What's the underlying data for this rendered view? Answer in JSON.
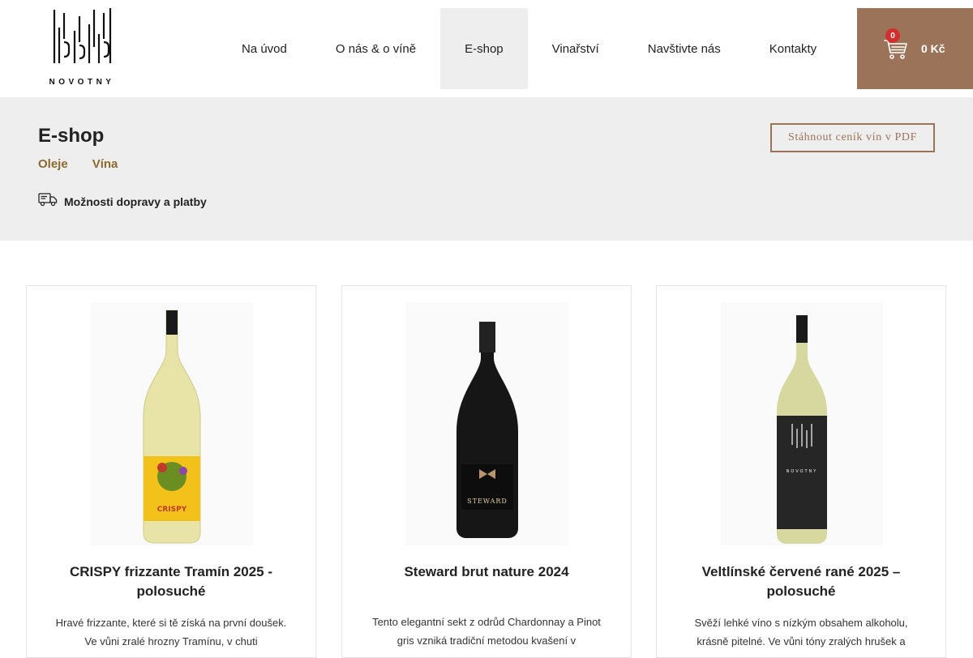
{
  "brand": {
    "name": "NOVOTNY"
  },
  "nav": {
    "items": [
      {
        "label": "Na úvod"
      },
      {
        "label": "O nás & o víně"
      },
      {
        "label": "E-shop"
      },
      {
        "label": "Vinařství"
      },
      {
        "label": "Navštivte nás"
      },
      {
        "label": "Kontakty"
      }
    ],
    "active": "E-shop"
  },
  "cart": {
    "count": "0",
    "total": "0 Kč",
    "icon": "cart-icon",
    "bg_color": "#9a7359",
    "badge_color": "#d32f2f"
  },
  "page": {
    "title": "E-shop",
    "categories": [
      {
        "label": "Oleje"
      },
      {
        "label": "Vína"
      }
    ],
    "shipping_label": "Možnosti dopravy a platby",
    "shipping_icon": "delivery-truck-icon",
    "pdf_button": "Stáhnout ceník vín v PDF",
    "accent_color": "#8c6a2e"
  },
  "products": [
    {
      "name": "CRISPY frizzante Tramín 2025 - polosuché",
      "description": "Hravé frizzante, které si tě získá na první doušek. Ve vůni zralé hrozny Tramínu, v chuti",
      "bottle_label": "CRISPY"
    },
    {
      "name": "Steward brut nature 2024",
      "description": "Tento elegantní sekt z odrůd Chardonnay a Pinot gris vzniká tradiční metodou kvašení v",
      "bottle_label": "STEWARD"
    },
    {
      "name": "Veltlínské červené rané 2025 – polosuché",
      "description": "Svěží lehké víno s nízkým obsahem alkoholu, krásně pitelné. Ve vůni tóny zralých hrušek a",
      "bottle_label": "NOVOTNY"
    }
  ]
}
